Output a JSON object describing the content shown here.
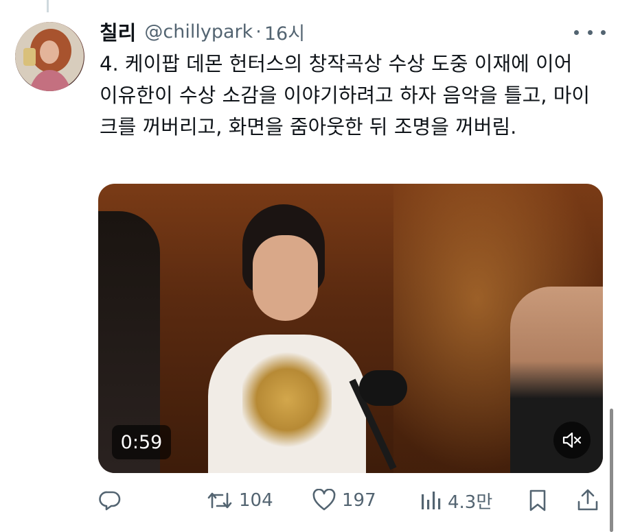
{
  "tweet": {
    "display_name": "칠리",
    "handle": "@chillypark",
    "separator": "·",
    "time": "16시",
    "text": "4. 케이팝 데몬 헌터스의 창작곡상 수상 도중 이재에 이어 이유한이 수상 소감을 이야기하려고 하자 음악을 틀고, 마이크를 꺼버리고, 화면을 줌아웃한 뒤 조명을 꺼버림."
  },
  "media": {
    "duration": "0:59",
    "mute_icon": "speaker-muted-icon"
  },
  "actions": {
    "reply_icon": "reply-icon",
    "retweet_count": "104",
    "like_count": "197",
    "views_count": "4.3만",
    "bookmark_icon": "bookmark-icon",
    "share_icon": "share-icon"
  },
  "colors": {
    "text_primary": "#0f1419",
    "text_secondary": "#536471",
    "thread_line": "#cfd9de"
  }
}
